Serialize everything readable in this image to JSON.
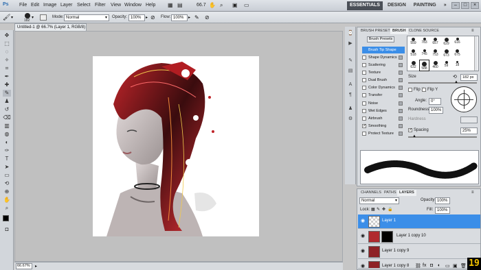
{
  "app": {
    "logo": "Ps"
  },
  "menubar": {
    "items": [
      "File",
      "Edit",
      "Image",
      "Layer",
      "Select",
      "Filter",
      "View",
      "Window",
      "Help"
    ],
    "zoom": "66.7",
    "workspaces": [
      "ESSENTIALS",
      "DESIGN",
      "PAINTING"
    ],
    "more": "»"
  },
  "options": {
    "size": "182",
    "mode_label": "Mode:",
    "mode_value": "Normal",
    "opacity_label": "Opacity:",
    "opacity_value": "100%",
    "flow_label": "Flow:",
    "flow_value": "100%"
  },
  "document": {
    "tab_title": "Untitled-1 @ 66.7% (Layer 1, RGB/8) *",
    "zoom_status": "66.67%"
  },
  "brush_panel": {
    "tabs": [
      "BRUSH PRESETS",
      "BRUSH",
      "CLONE SOURCE"
    ],
    "presets_button": "Brush Presets",
    "options": [
      {
        "label": "Brush Tip Shape",
        "checked": false,
        "selected": true
      },
      {
        "label": "Shape Dynamics",
        "checked": false
      },
      {
        "label": "Scattering",
        "checked": false
      },
      {
        "label": "Texture",
        "checked": false
      },
      {
        "label": "Dual Brush",
        "checked": false
      },
      {
        "label": "Color Dynamics",
        "checked": false
      },
      {
        "label": "Transfer",
        "checked": false
      },
      {
        "label": "Noise",
        "checked": false
      },
      {
        "label": "Wet Edges",
        "checked": false
      },
      {
        "label": "Airbrush",
        "checked": false
      },
      {
        "label": "Smoothing",
        "checked": true
      },
      {
        "label": "Protect Texture",
        "checked": false
      }
    ],
    "tips": [
      "559",
      "783",
      "657",
      "629",
      "616",
      "518",
      "745",
      "753",
      "673",
      "675",
      "632",
      "588",
      "460",
      "59",
      "18"
    ],
    "size_label": "Size",
    "size_value": "182 px",
    "flip_x": "Flip X",
    "flip_y": "Flip Y",
    "angle_label": "Angle:",
    "angle_value": "0°",
    "roundness_label": "Roundness:",
    "roundness_value": "100%",
    "hardness_label": "Hardness",
    "spacing_label": "Spacing",
    "spacing_value": "25%"
  },
  "layers_panel": {
    "tabs": [
      "CHANNELS",
      "PATHS",
      "LAYERS"
    ],
    "blend_mode": "Normal",
    "opacity_label": "Opacity:",
    "opacity_value": "100%",
    "lock_label": "Lock:",
    "fill_label": "Fill:",
    "fill_value": "100%",
    "layers": [
      {
        "name": "Layer 1",
        "selected": true
      },
      {
        "name": "Layer 1 copy 10",
        "selected": false
      },
      {
        "name": "Layer 1 copy 9",
        "selected": false
      },
      {
        "name": "Layer 1 copy 8",
        "selected": false
      }
    ]
  },
  "badge": "19",
  "colors": {
    "accent": "#3b8ee8",
    "badge_bg": "#000000",
    "badge_fg": "#f3c400"
  }
}
